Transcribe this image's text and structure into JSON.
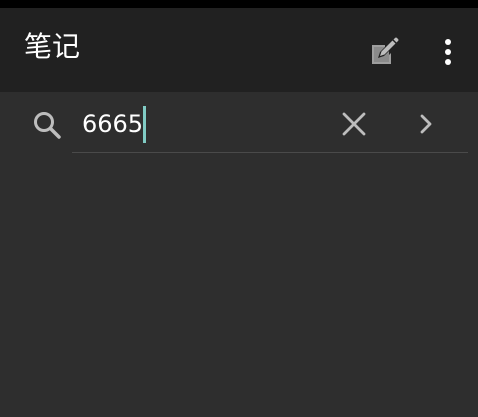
{
  "app_bar": {
    "title": "笔记",
    "background": "#212121",
    "icons": {
      "compose": "note-edit-icon",
      "overflow": "more-vert-icon"
    }
  },
  "search": {
    "query": "6665",
    "placeholder": "",
    "cursor_color": "#80cbc4",
    "icons": {
      "search": "search-icon",
      "clear": "close-icon",
      "next": "chevron-right-icon"
    }
  },
  "colors": {
    "page_background": "#2e2e2e",
    "text": "#ffffff",
    "icon": "#bdbdbd"
  }
}
